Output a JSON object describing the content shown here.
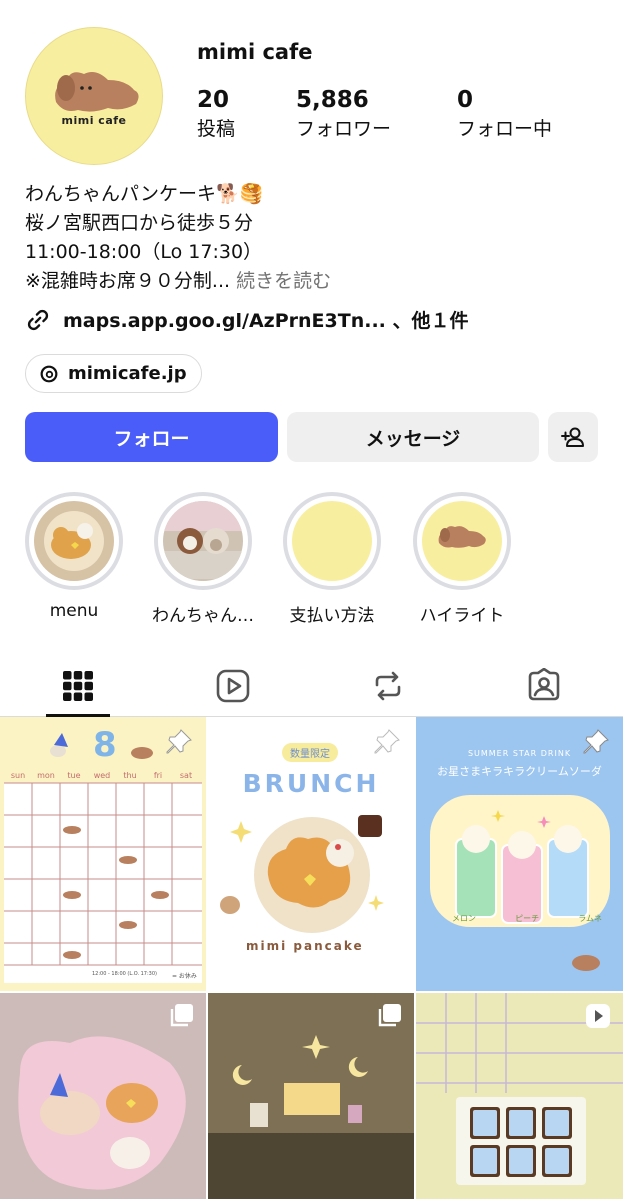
{
  "profile": {
    "username": "mimi cafe",
    "avatar_logo_text": "mimi cafe",
    "stats": [
      {
        "value": "20",
        "label": "投稿"
      },
      {
        "value": "5,886",
        "label": "フォロワー"
      },
      {
        "value": "0",
        "label": "フォロー中"
      }
    ]
  },
  "bio": {
    "line1": "わんちゃんパンケーキ🐕🥞",
    "line2": "桜ノ宮駅西口から徒歩５分",
    "line3": "11:00-18:00（Lo 17:30）",
    "line4": "※混雑時お席９０分制...",
    "more": "続きを読む",
    "link": "maps.app.goo.gl/AzPrnE3Tn... 、他１件",
    "threads": "mimicafe.jp"
  },
  "actions": {
    "follow": "フォロー",
    "message": "メッセージ"
  },
  "highlights": [
    {
      "label": "menu"
    },
    {
      "label": "わんちゃん…"
    },
    {
      "label": "支払い方法"
    },
    {
      "label": "ハイライト"
    }
  ],
  "tabs": [
    "grid-icon",
    "reels-icon",
    "reposts-icon",
    "tagged-icon"
  ],
  "posts": {
    "p1": {
      "month": "8",
      "days": [
        "sun",
        "mon",
        "tue",
        "wed",
        "thu",
        "fri",
        "sat"
      ],
      "footer": "12:00 - 18:00 (L.O. 17:30)",
      "note": "= お休み"
    },
    "p2": {
      "tag": "数量限定",
      "title": "BRUNCH",
      "caption": "mimi pancake"
    },
    "p3": {
      "eyebrow": "SUMMER STAR DRINK",
      "title": "お星さまキラキラクリームソーダ",
      "labels": [
        "メロン",
        "ピーチ",
        "ラムネ"
      ]
    }
  },
  "colors": {
    "accent": "#4a5df9",
    "avatar_bg": "#f8eea0",
    "muted": "#737373"
  }
}
